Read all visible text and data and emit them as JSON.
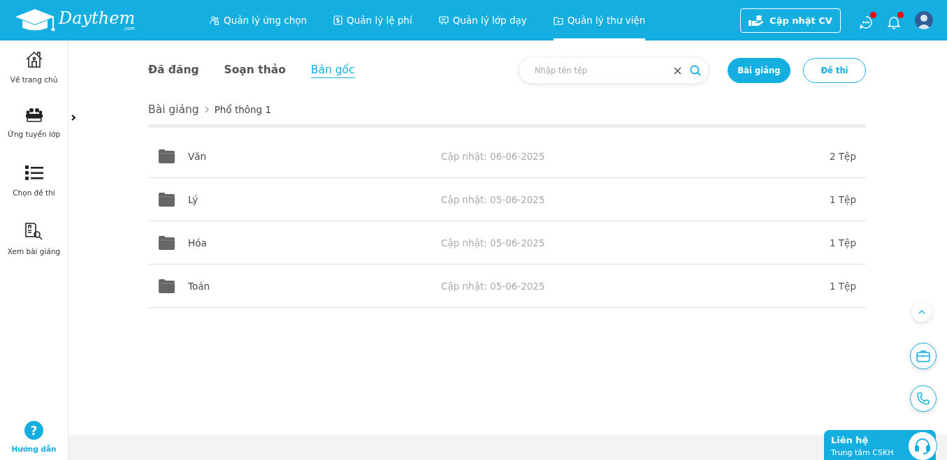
{
  "logo": {
    "name": "Daythem",
    "suffix": ".com"
  },
  "nav": [
    {
      "label": "Quản lý ứng chọn",
      "kind": "people",
      "selected": false
    },
    {
      "label": "Quản lý lệ phí",
      "kind": "dollar",
      "selected": false
    },
    {
      "label": "Quản lý lớp dạy",
      "kind": "board",
      "selected": false
    },
    {
      "label": "Quản lý thư viện",
      "kind": "folder",
      "selected": true
    }
  ],
  "update_cv_button": "Cập nhật CV",
  "header_icons": [
    {
      "kind": "chat",
      "badge": true
    },
    {
      "kind": "bell",
      "badge": true
    }
  ],
  "sidebar": {
    "items": [
      {
        "label": "Về trang chủ",
        "kind": "home",
        "expandable": false
      },
      {
        "label": "Ứng tuyển lớp",
        "kind": "class",
        "expandable": true
      },
      {
        "label": "Chọn đề thi",
        "kind": "list",
        "expandable": false
      },
      {
        "label": "Xem bài giảng",
        "kind": "doc",
        "expandable": false
      }
    ],
    "help": {
      "icon": "?",
      "label": "Hướng dẫn"
    }
  },
  "tabs": [
    {
      "label": "Đã đăng",
      "selected": false
    },
    {
      "label": "Soạn thảo",
      "selected": false
    },
    {
      "label": "Bản gốc",
      "selected": true
    }
  ],
  "search": {
    "placeholder": "Nhập tên tệp"
  },
  "type_buttons": [
    {
      "label": "Bài giảng",
      "selected": true
    },
    {
      "label": "Đề thi",
      "selected": false
    }
  ],
  "breadcrumb": [
    "Bài giảng",
    "Phổ thông 1"
  ],
  "folders": [
    {
      "name": "Văn",
      "updated": "Cập nhật: 06-06-2025",
      "count": "2 Tệp"
    },
    {
      "name": "Lý",
      "updated": "Cập nhật: 05-06-2025",
      "count": "1 Tệp"
    },
    {
      "name": "Hóa",
      "updated": "Cập nhật: 05-06-2025",
      "count": "1 Tệp"
    },
    {
      "name": "Toán",
      "updated": "Cập nhật: 05-06-2025",
      "count": "1 Tệp"
    }
  ],
  "contact": {
    "title": "Liên hệ",
    "subtitle": "Trung tâm CSKH"
  }
}
